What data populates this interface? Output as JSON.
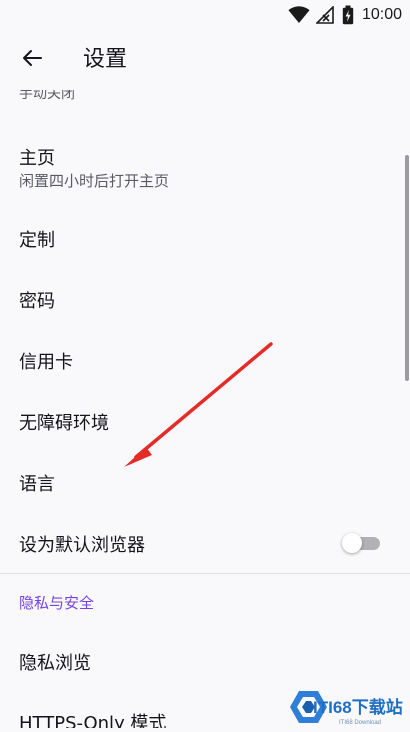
{
  "status_bar": {
    "time": "10:00",
    "icons": [
      "wifi-icon",
      "signal-icon",
      "battery-icon"
    ]
  },
  "toolbar": {
    "back_icon": "back-arrow-icon",
    "title": "设置"
  },
  "settings": {
    "partial_summary": "手动关闭",
    "items": [
      {
        "title": "主页",
        "summary": "闲置四小时后打开主页"
      },
      {
        "title": "定制"
      },
      {
        "title": "密码"
      },
      {
        "title": "信用卡"
      },
      {
        "title": "无障碍环境"
      },
      {
        "title": "语言"
      },
      {
        "title": "设为默认浏览器",
        "toggle_on": false
      }
    ],
    "section_header": "隐私与安全",
    "section_items": [
      {
        "title": "隐私浏览"
      },
      {
        "title": "HTTPS-Only 模式"
      }
    ]
  },
  "watermark": {
    "brand": "ITI68下载站",
    "sub": "ITI68 Download"
  },
  "colors": {
    "accent": "#7542e5",
    "background": "#f9f9fb",
    "annotation_arrow": "#e52b27"
  }
}
